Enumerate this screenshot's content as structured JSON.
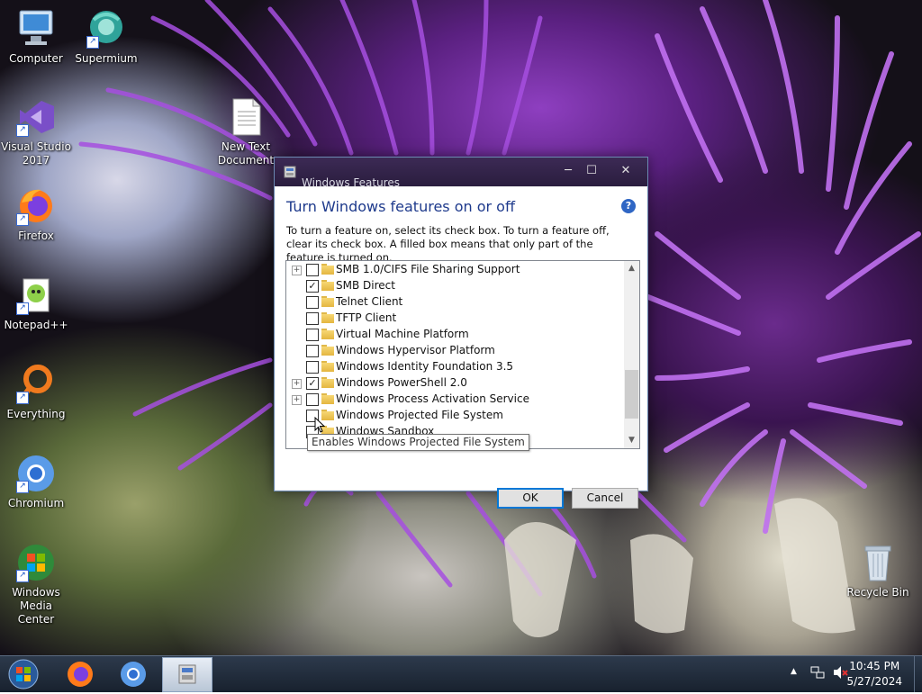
{
  "desktop": {
    "icons": [
      {
        "label": "Computer"
      },
      {
        "label": "Supermium"
      },
      {
        "label": "Visual Studio 2017"
      },
      {
        "label": "New Text Document"
      },
      {
        "label": "Firefox"
      },
      {
        "label": "Notepad++"
      },
      {
        "label": "Everything"
      },
      {
        "label": "Chromium"
      },
      {
        "label": "Windows Media Center"
      },
      {
        "label": "Recycle Bin"
      }
    ]
  },
  "dialog": {
    "window_title": "Windows Features",
    "heading": "Turn Windows features on or off",
    "description": "To turn a feature on, select its check box. To turn a feature off, clear its check box. A filled box means that only part of the feature is turned on.",
    "ok_label": "OK",
    "cancel_label": "Cancel",
    "features": [
      {
        "label": "SMB 1.0/CIFS File Sharing Support",
        "expandable": true,
        "checked": false
      },
      {
        "label": "SMB Direct",
        "expandable": false,
        "checked": true
      },
      {
        "label": "Telnet Client",
        "expandable": false,
        "checked": false
      },
      {
        "label": "TFTP Client",
        "expandable": false,
        "checked": false
      },
      {
        "label": "Virtual Machine Platform",
        "expandable": false,
        "checked": false
      },
      {
        "label": "Windows Hypervisor Platform",
        "expandable": false,
        "checked": false
      },
      {
        "label": "Windows Identity Foundation 3.5",
        "expandable": false,
        "checked": false
      },
      {
        "label": "Windows PowerShell 2.0",
        "expandable": true,
        "checked": true
      },
      {
        "label": "Windows Process Activation Service",
        "expandable": true,
        "checked": false
      },
      {
        "label": "Windows Projected File System",
        "expandable": false,
        "checked": false
      },
      {
        "label": "Windows Sandbox",
        "expandable": false,
        "checked": false
      }
    ],
    "tooltip": "Enables Windows Projected File System"
  },
  "taskbar": {
    "time": "10:45 PM",
    "date": "5/27/2024"
  },
  "colors": {
    "heading": "#1e3a8c",
    "accent": "#0078d7",
    "taskbar": "#18212e"
  }
}
